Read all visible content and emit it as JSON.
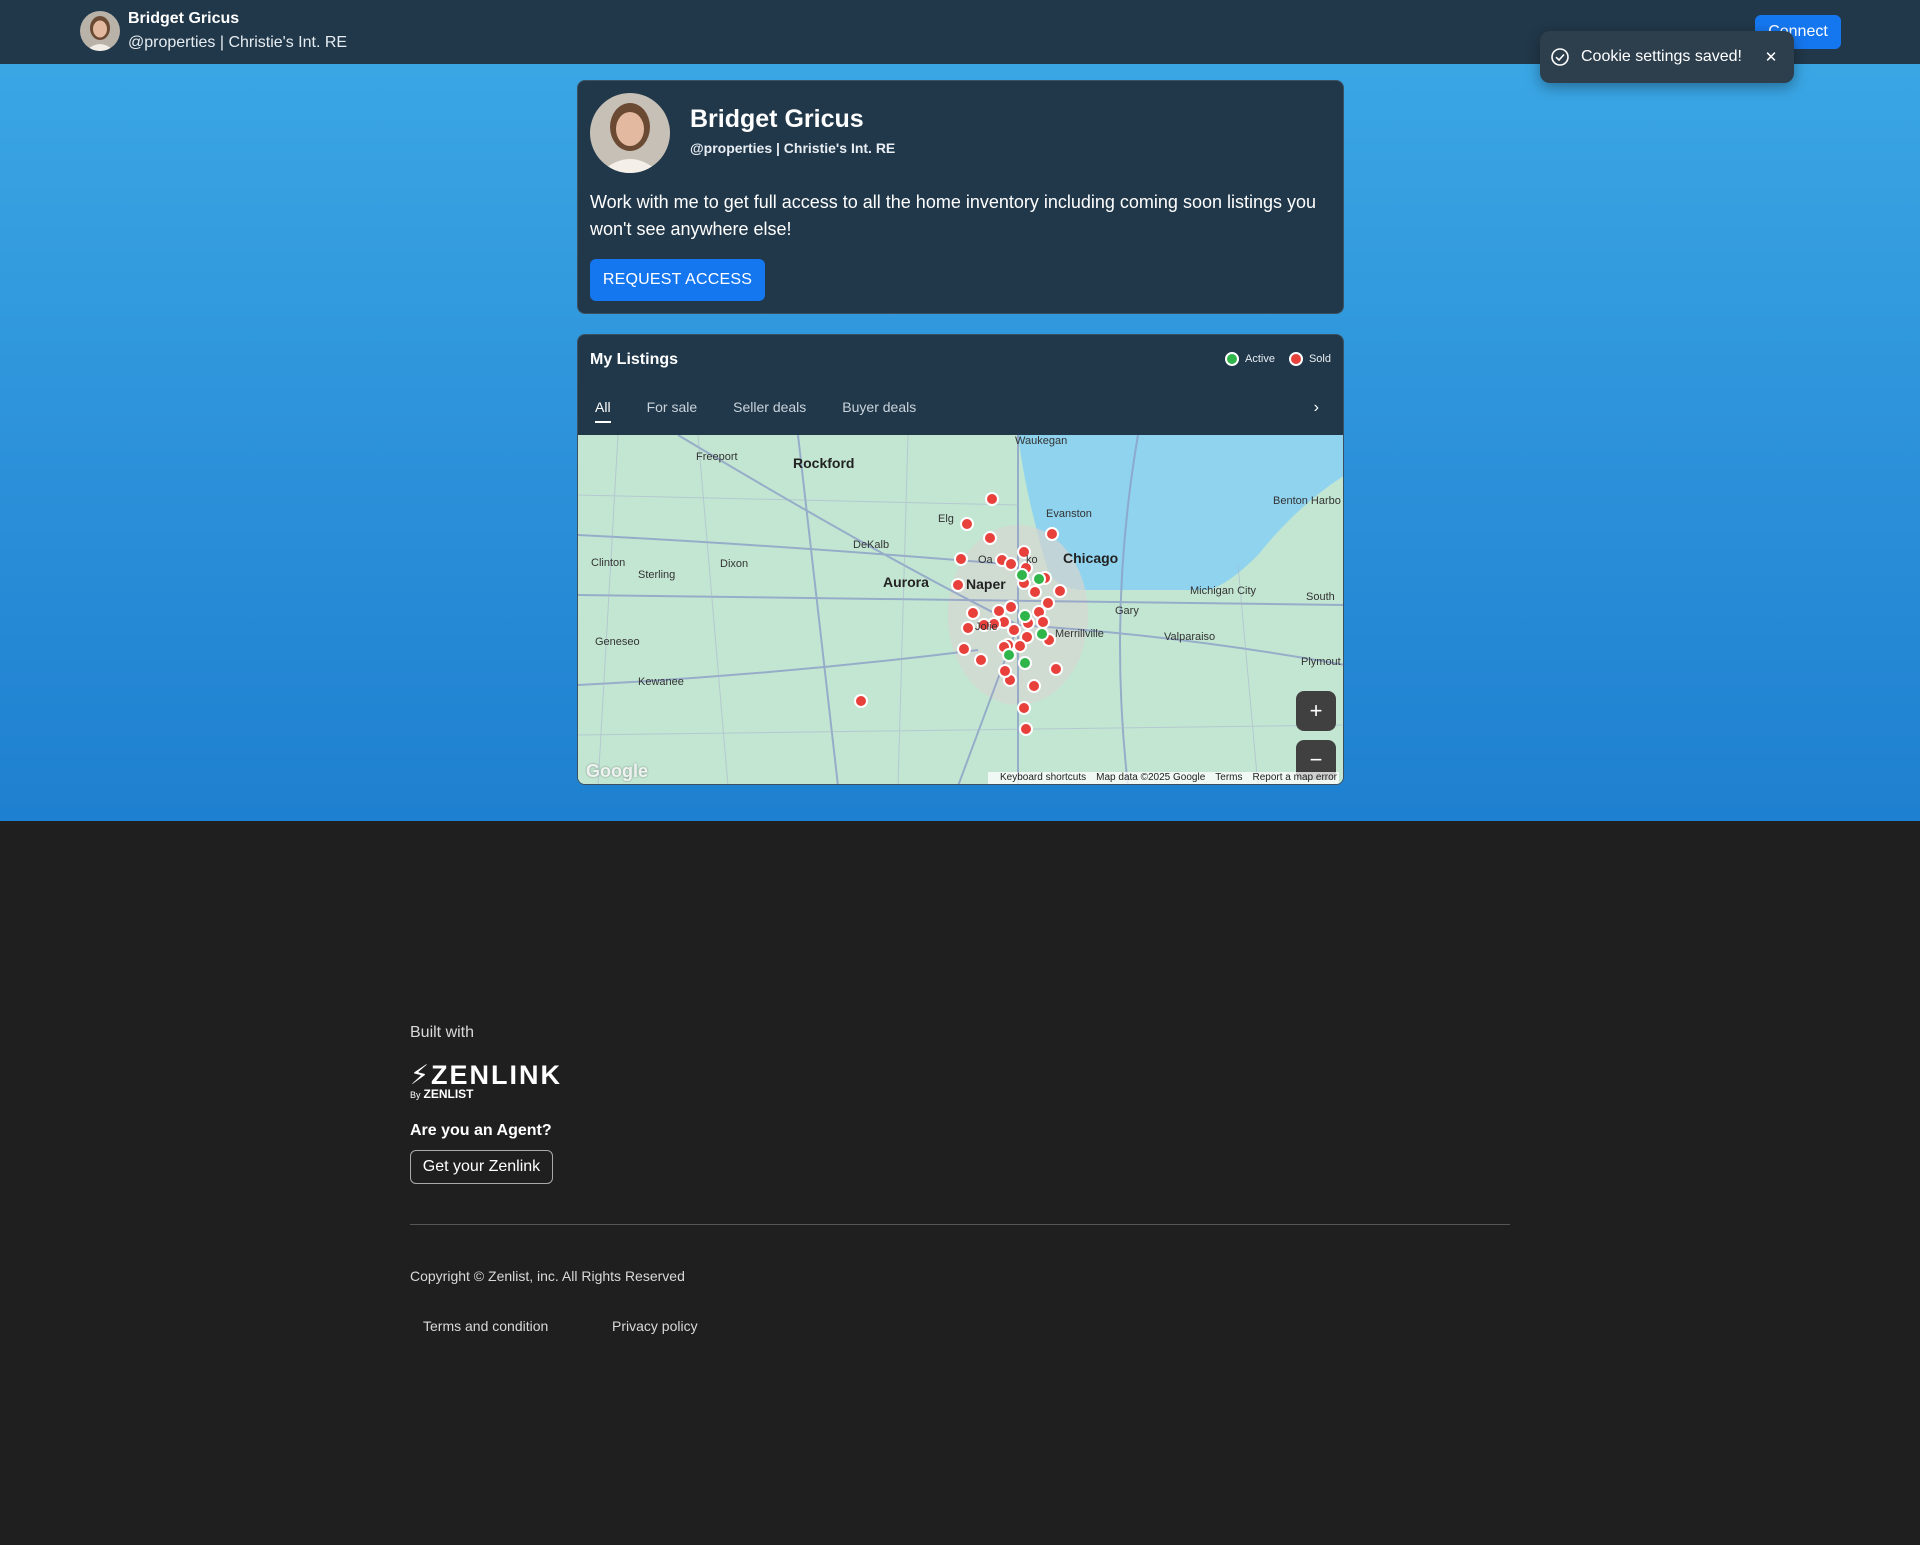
{
  "header": {
    "name": "Bridget Gricus",
    "subtitle": "@properties | Christie's Int. RE",
    "connect_label": "Connect"
  },
  "toast": {
    "message": "Cookie settings saved!",
    "close_label": "✕"
  },
  "profile": {
    "name": "Bridget Gricus",
    "subtitle": "@properties | Christie's Int. RE",
    "pitch": "Work with me to get full access to all the home inventory including coming soon listings you won't see anywhere else!",
    "request_label": "REQUEST ACCESS"
  },
  "listings": {
    "title": "My Listings",
    "legend": [
      {
        "label": "Active",
        "color": "#2fb54a"
      },
      {
        "label": "Sold",
        "color": "#e8403b"
      }
    ],
    "tabs": [
      "All",
      "For sale",
      "Seller deals",
      "Buyer deals"
    ],
    "active_tab": "All",
    "next_icon": "chevron-right-icon"
  },
  "map": {
    "labels": {
      "waukegan": "Waukegan",
      "freeport": "Freeport",
      "rockford": "Rockford",
      "evanston": "Evanston",
      "benton_harbor": "Benton Harbo",
      "elgin": "Elg",
      "dekalb": "DeKalb",
      "oakbrook": "Oa",
      "oakbrook2": "ko",
      "chicago": "Chicago",
      "clinton": "Clinton",
      "sterling": "Sterling",
      "dixon": "Dixon",
      "aurora": "Aurora",
      "naperville": "Naper",
      "michigan_city": "Michigan City",
      "south": "South",
      "gary": "Gary",
      "joliet": "Jolie",
      "merrillville": "Merrillville",
      "valparaiso": "Valparaiso",
      "geneseo": "Geneseo",
      "plymouth": "Plymout",
      "kewanee": "Kewanee"
    },
    "zoom_in": "+",
    "zoom_out": "−",
    "google": "Google",
    "attribution": {
      "shortcuts": "Keyboard shortcuts",
      "data": "Map data ©2025 Google",
      "terms": "Terms",
      "report": "Report a map error"
    }
  },
  "footer": {
    "built_with": "Built with",
    "logo_main": "ZENLINK",
    "logo_by": "By",
    "logo_sub": "ZENLIST",
    "agent_question": "Are you an Agent?",
    "get_label": "Get your Zenlink",
    "copyright": "Copyright © Zenlist, inc. All Rights Reserved",
    "links": [
      "Terms and condition",
      "Privacy policy"
    ]
  }
}
